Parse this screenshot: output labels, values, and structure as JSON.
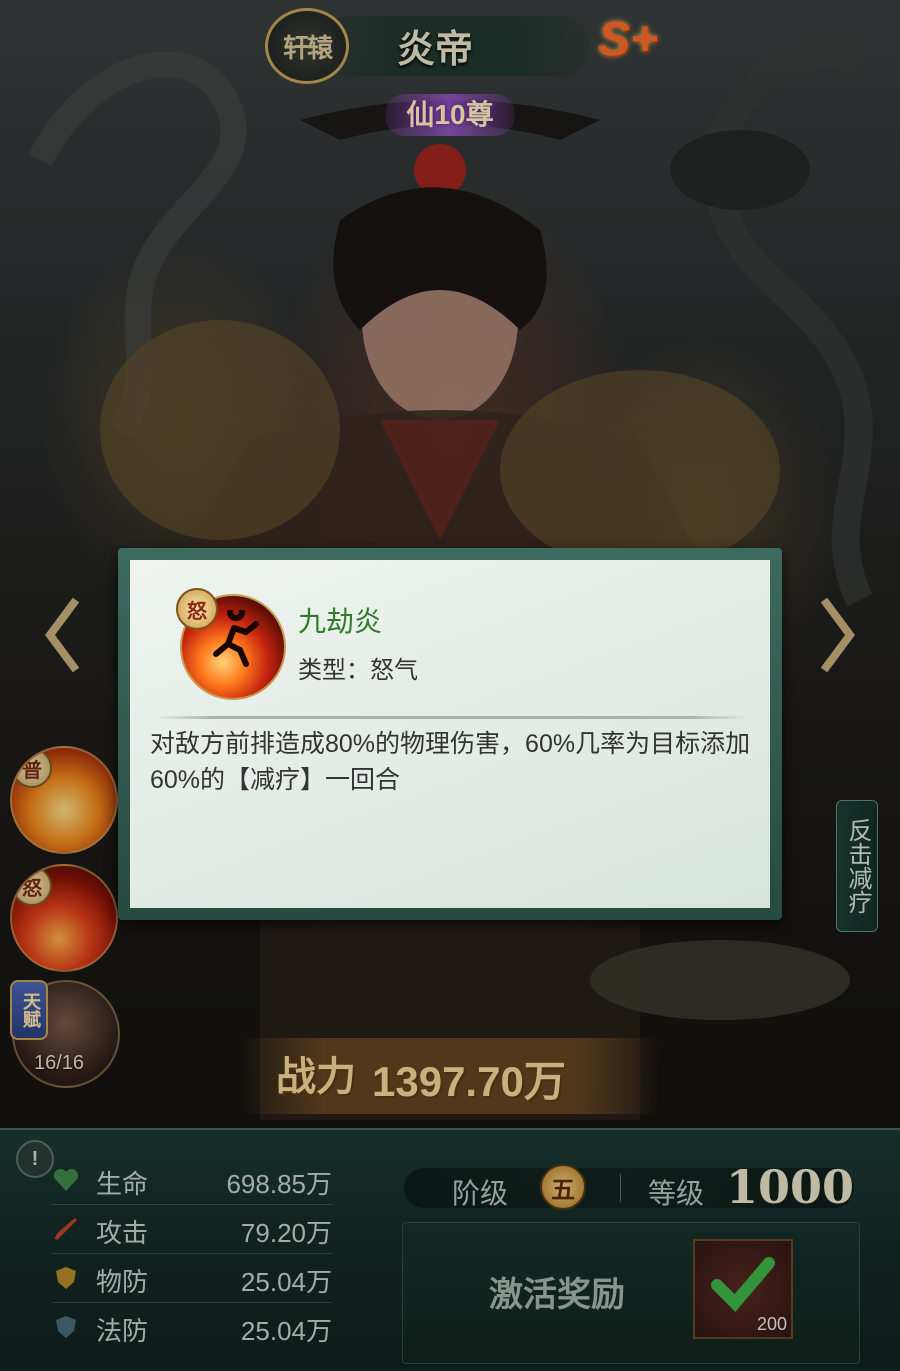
{
  "header": {
    "faction": "轩辕",
    "hero_name": "炎帝",
    "rank": "S+",
    "star_rank": "仙10尊"
  },
  "skills": [
    {
      "tag": "普"
    },
    {
      "tag": "怒"
    }
  ],
  "talent": {
    "tag": "天赋",
    "count": "16/16"
  },
  "side_tag": "反击减疗",
  "power": {
    "label": "战力",
    "value": "1397.70万"
  },
  "stats": [
    {
      "name": "生命",
      "value": "698.85万",
      "icon": "heart-icon"
    },
    {
      "name": "攻击",
      "value": "79.20万",
      "icon": "sword-icon"
    },
    {
      "name": "物防",
      "value": "25.04万",
      "icon": "shield-icon"
    },
    {
      "name": "法防",
      "value": "25.04万",
      "icon": "magic-shield-icon"
    }
  ],
  "level": {
    "stage_label": "阶级",
    "stage_value": "五",
    "level_label": "等级",
    "level_value": "1000"
  },
  "reward": {
    "label": "激活奖励",
    "count": "200"
  },
  "tooltip": {
    "badge": "怒",
    "skill_name": "九劫炎",
    "type_label": "类型：",
    "type_value": "怒气",
    "description": "对敌方前排造成80%的物理伤害，60%几率为目标添加60%的【减疗】一回合"
  },
  "colors": {
    "skill_name": "#2f7a2b",
    "rank": "#ff6a2a",
    "panel": "#1d3a34"
  }
}
